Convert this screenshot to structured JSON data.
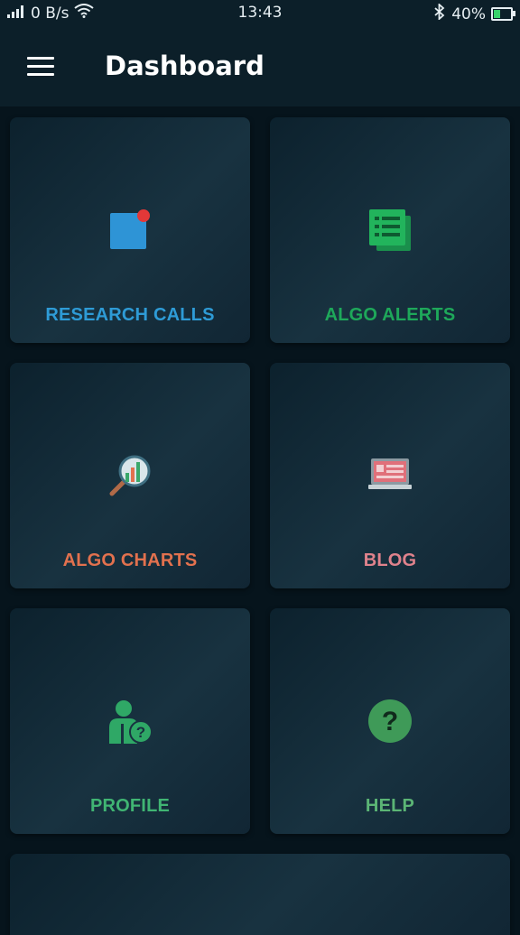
{
  "status_bar": {
    "signal_icon": "signal-icon",
    "network_speed": "0 B/s",
    "wifi_icon": "wifi-icon",
    "time": "13:43",
    "bluetooth_icon": "bluetooth-icon",
    "battery_percent": "40%",
    "battery_level": 0.4,
    "battery_color": "#39d36b"
  },
  "app_bar": {
    "menu_icon": "hamburger-menu-icon",
    "title": "Dashboard"
  },
  "tiles": [
    {
      "label": "RESEARCH CALLS",
      "icon": "notification-square-icon",
      "color": "#2e9bd6"
    },
    {
      "label": "ALGO ALERTS",
      "icon": "document-list-icon",
      "color": "#1ea85a"
    },
    {
      "label": "ALGO CHARTS",
      "icon": "magnifier-chart-icon",
      "color": "#e2714e"
    },
    {
      "label": "BLOG",
      "icon": "laptop-blog-icon",
      "color": "#e0828c"
    },
    {
      "label": "PROFILE",
      "icon": "user-help-icon",
      "color": "#40b573"
    },
    {
      "label": "HELP",
      "icon": "question-circle-icon",
      "color": "#5bb575"
    }
  ],
  "colors": {
    "background": "#06141c",
    "app_bar": "#0c1f29"
  }
}
